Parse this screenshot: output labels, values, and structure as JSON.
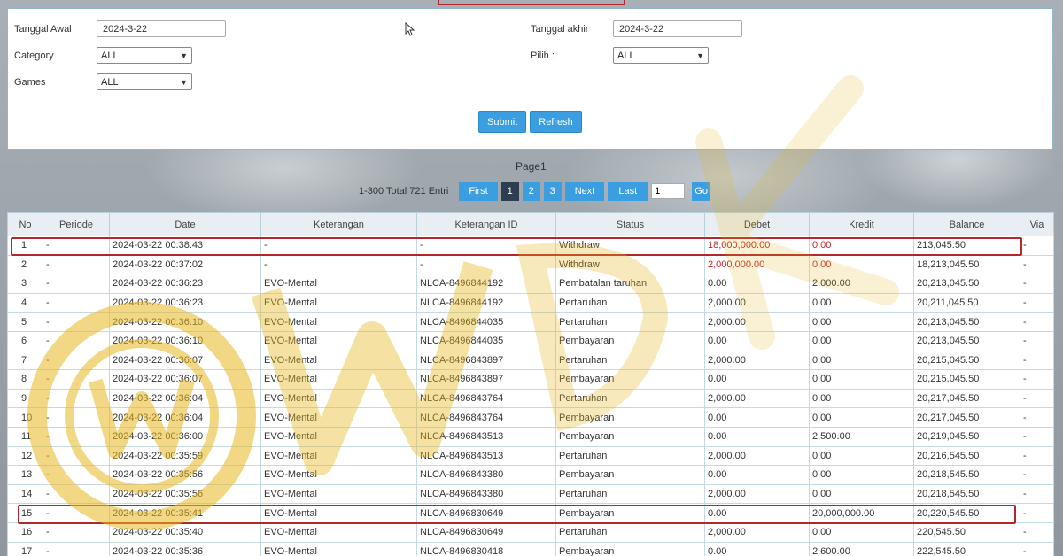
{
  "filters": {
    "tanggal_awal_label": "Tanggal Awal",
    "tanggal_awal_value": "2024-3-22",
    "tanggal_akhir_label": "Tanggal akhir",
    "tanggal_akhir_value": "2024-3-22",
    "category_label": "Category",
    "category_value": "ALL",
    "pilih_label": "Pilih  :",
    "pilih_value": "ALL",
    "games_label": "Games",
    "games_value": "ALL",
    "submit_label": "Submit",
    "refresh_label": "Refresh"
  },
  "pagination": {
    "page_label": "Page1",
    "info": "1-300 Total 721 Entri",
    "first": "First",
    "pages": [
      "1",
      "2",
      "3"
    ],
    "active_page": "1",
    "next": "Next",
    "last": "Last",
    "jump_value": "1",
    "go": "Go"
  },
  "table": {
    "headers": [
      "No",
      "Periode",
      "Date",
      "Keterangan",
      "Keterangan ID",
      "Status",
      "Debet",
      "Kredit",
      "Balance",
      "Via"
    ],
    "rows": [
      [
        "1",
        "-",
        "2024-03-22 00:38:43",
        "-",
        "-",
        "Withdraw",
        "18,000,000.00",
        "0.00",
        "213,045.50",
        "-"
      ],
      [
        "2",
        "-",
        "2024-03-22 00:37:02",
        "-",
        "-",
        "Withdraw",
        "2,000,000.00",
        "0.00",
        "18,213,045.50",
        "-"
      ],
      [
        "3",
        "-",
        "2024-03-22 00:36:23",
        "EVO-Mental",
        "NLCA-8496844192",
        "Pembatalan taruhan",
        "0.00",
        "2,000.00",
        "20,213,045.50",
        "-"
      ],
      [
        "4",
        "-",
        "2024-03-22 00:36:23",
        "EVO-Mental",
        "NLCA-8496844192",
        "Pertaruhan",
        "2,000.00",
        "0.00",
        "20,211,045.50",
        "-"
      ],
      [
        "5",
        "-",
        "2024-03-22 00:36:10",
        "EVO-Mental",
        "NLCA-8496844035",
        "Pertaruhan",
        "2,000.00",
        "0.00",
        "20,213,045.50",
        "-"
      ],
      [
        "6",
        "-",
        "2024-03-22 00:36:10",
        "EVO-Mental",
        "NLCA-8496844035",
        "Pembayaran",
        "0.00",
        "0.00",
        "20,213,045.50",
        "-"
      ],
      [
        "7",
        "-",
        "2024-03-22 00:36:07",
        "EVO-Mental",
        "NLCA-8496843897",
        "Pertaruhan",
        "2,000.00",
        "0.00",
        "20,215,045.50",
        "-"
      ],
      [
        "8",
        "-",
        "2024-03-22 00:36:07",
        "EVO-Mental",
        "NLCA-8496843897",
        "Pembayaran",
        "0.00",
        "0.00",
        "20,215,045.50",
        "-"
      ],
      [
        "9",
        "-",
        "2024-03-22 00:36:04",
        "EVO-Mental",
        "NLCA-8496843764",
        "Pertaruhan",
        "2,000.00",
        "0.00",
        "20,217,045.50",
        "-"
      ],
      [
        "10",
        "-",
        "2024-03-22 00:36:04",
        "EVO-Mental",
        "NLCA-8496843764",
        "Pembayaran",
        "0.00",
        "0.00",
        "20,217,045.50",
        "-"
      ],
      [
        "11",
        "-",
        "2024-03-22 00:36:00",
        "EVO-Mental",
        "NLCA-8496843513",
        "Pembayaran",
        "0.00",
        "2,500.00",
        "20,219,045.50",
        "-"
      ],
      [
        "12",
        "-",
        "2024-03-22 00:35:59",
        "EVO-Mental",
        "NLCA-8496843513",
        "Pertaruhan",
        "2,000.00",
        "0.00",
        "20,216,545.50",
        "-"
      ],
      [
        "13",
        "-",
        "2024-03-22 00:35:56",
        "EVO-Mental",
        "NLCA-8496843380",
        "Pembayaran",
        "0.00",
        "0.00",
        "20,218,545.50",
        "-"
      ],
      [
        "14",
        "-",
        "2024-03-22 00:35:56",
        "EVO-Mental",
        "NLCA-8496843380",
        "Pertaruhan",
        "2,000.00",
        "0.00",
        "20,218,545.50",
        "-"
      ],
      [
        "15",
        "-",
        "2024-03-22 00:35:41",
        "EVO-Mental",
        "NLCA-8496830649",
        "Pembayaran",
        "0.00",
        "20,000,000.00",
        "20,220,545.50",
        "-"
      ],
      [
        "16",
        "-",
        "2024-03-22 00:35:40",
        "EVO-Mental",
        "NLCA-8496830649",
        "Pertaruhan",
        "2,000.00",
        "0.00",
        "220,545.50",
        "-"
      ],
      [
        "17",
        "-",
        "2024-03-22 00:35:36",
        "EVO-Mental",
        "NLCA-8496830418",
        "Pembayaran",
        "0.00",
        "2,600.00",
        "222,545.50",
        "-"
      ]
    ]
  },
  "colors": {
    "accent_blue": "#3a9ee0",
    "active_page": "#2d3e50",
    "highlight_red": "#b3262a",
    "debit_red": "#c0262b",
    "watermark_gold": "#e8b820"
  },
  "icons": [
    "mouse-cursor-icon",
    "chevron-down-icon",
    "watermark-logo"
  ]
}
